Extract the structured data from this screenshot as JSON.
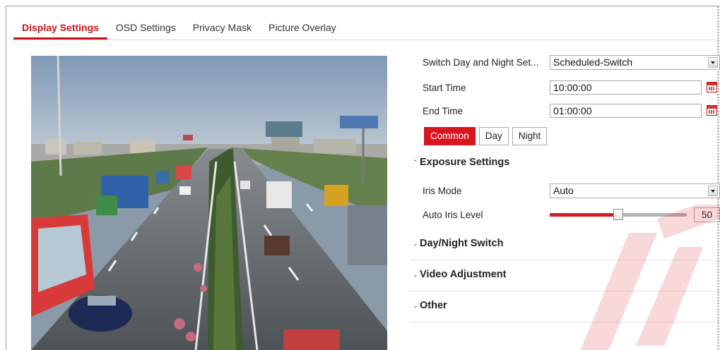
{
  "tabs": [
    {
      "label": "Display Settings",
      "active": true
    },
    {
      "label": "OSD Settings",
      "active": false
    },
    {
      "label": "Privacy Mask",
      "active": false
    },
    {
      "label": "Picture Overlay",
      "active": false
    }
  ],
  "form": {
    "switch_day_night": {
      "label": "Switch Day and Night Set...",
      "value": "Scheduled-Switch"
    },
    "start_time": {
      "label": "Start Time",
      "value": "10:00:00"
    },
    "end_time": {
      "label": "End Time",
      "value": "01:00:00"
    },
    "mode_buttons": [
      {
        "label": "Common",
        "active": true
      },
      {
        "label": "Day",
        "active": false
      },
      {
        "label": "Night",
        "active": false
      }
    ],
    "exposure": {
      "title": "Exposure Settings",
      "expanded": true,
      "iris_mode": {
        "label": "Iris Mode",
        "value": "Auto"
      },
      "auto_iris_level": {
        "label": "Auto Iris Level",
        "value": "50",
        "fraction": 0.5
      }
    },
    "sections": [
      {
        "title": "Day/Night Switch",
        "expanded": false
      },
      {
        "title": "Video Adjustment",
        "expanded": false
      },
      {
        "title": "Other",
        "expanded": false
      }
    ]
  },
  "icons": {
    "calendar": "calendar-icon",
    "dropdown": "chevron-down-icon",
    "collapse": "chevron-up-icon",
    "expand": "chevron-down-icon"
  },
  "colors": {
    "accent": "#d9161f",
    "slider_track": "#b4b4b4"
  }
}
